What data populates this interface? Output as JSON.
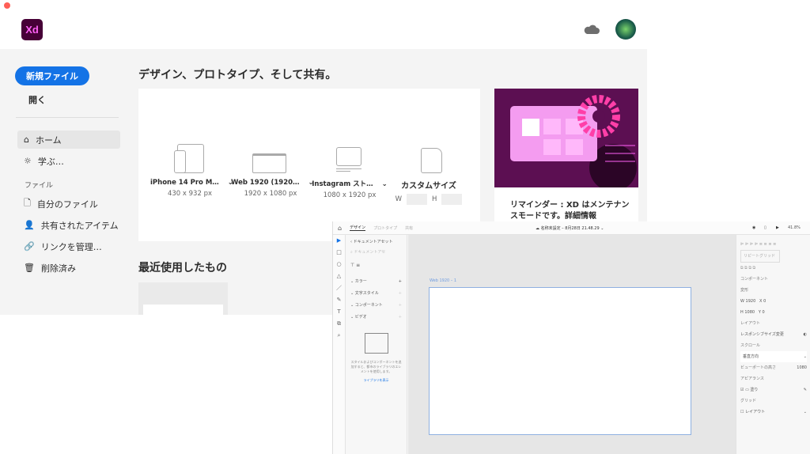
{
  "app": {
    "logo": "Xd",
    "cloud_icon": "cloud-icon",
    "accent": "#1473e6"
  },
  "sidebar": {
    "new_file": "新規ファイル",
    "open": "開く",
    "items": [
      {
        "label": "ホーム",
        "icon": "home-icon",
        "selected": true
      },
      {
        "label": "学ぶ…",
        "icon": "lightbulb-icon"
      }
    ],
    "files_section": "ファイル",
    "file_items": [
      {
        "label": "自分のファイル",
        "icon": "file-icon"
      },
      {
        "label": "共有されたアイテム",
        "icon": "people-icon"
      },
      {
        "label": "リンクを管理…",
        "icon": "link-icon"
      },
      {
        "label": "削除済み",
        "icon": "trash-icon"
      }
    ]
  },
  "main": {
    "heading": "デザイン、プロトタイプ、そして共有。",
    "presets": [
      {
        "name": "iPhone 14 Pro M…",
        "size": "430 x 932 px"
      },
      {
        "name": "Web 1920 (1920…",
        "size": "1920 x 1080 px"
      },
      {
        "name": "Instagram スト…",
        "size": "1080 x 1920 px"
      }
    ],
    "custom": {
      "name": "カスタムサイズ",
      "w_label": "W",
      "h_label": "H"
    },
    "promo": "リマインダー : XD はメンテナンスモードです。詳細情報",
    "recent": "最近使用したもの"
  },
  "editor": {
    "tabs": [
      "デザイン",
      "プロトタイプ",
      "共有"
    ],
    "doc_title": "名称未設定 – 8月28日 21.48.29",
    "zoom": "41.8%",
    "panel": {
      "back": "ドキュメントアセット",
      "search_placeholder": "ドキュメントアセ",
      "sections": [
        "カラー",
        "文字スタイル",
        "コンポーネント",
        "ビデオ"
      ],
      "empty_text": "スタイルおよびコンポーネントを追加すると、都市のライブラリのエレメントを使用します。",
      "library_link": "ライブラリを表示"
    },
    "artboard_label": "Web 1920 – 1",
    "right": {
      "repeat_grid": "リピートグリッド",
      "component": "コンポーネント",
      "size": "変形",
      "w": "1920",
      "h": "1080",
      "x": "0",
      "y": "0",
      "layout": "レイアウト",
      "responsive": "レスポンシブサイズ変更",
      "scroll": "スクロール",
      "scroll_value": "垂直方向",
      "viewport": "ビューポートの高さ",
      "viewport_value": "1080",
      "appearance": "アピアランス",
      "fill": "塗り",
      "grid": "グリッド",
      "grid_value": "レイアウト"
    }
  }
}
